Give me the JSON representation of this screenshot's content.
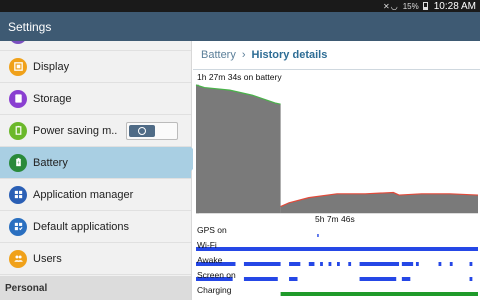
{
  "status_bar": {
    "battery_percent": "15%",
    "time": "10:28 AM"
  },
  "app_bar": {
    "title": "Settings"
  },
  "sidebar": {
    "items": [
      {
        "label": "Display",
        "icon": "display-icon",
        "color": "#f0a11a"
      },
      {
        "label": "Storage",
        "icon": "storage-icon",
        "color": "#8a3fd1"
      },
      {
        "label": "Power saving m..",
        "icon": "power-saving-icon",
        "color": "#6bb82a",
        "toggle": "on"
      },
      {
        "label": "Battery",
        "icon": "battery-icon",
        "color": "#2a8a3a",
        "active": true
      },
      {
        "label": "Application manager",
        "icon": "apps-grid-icon",
        "color": "#2a5fb5"
      },
      {
        "label": "Default applications",
        "icon": "default-apps-icon",
        "color": "#2a6fc0"
      },
      {
        "label": "Users",
        "icon": "users-icon",
        "color": "#f0a11a"
      }
    ],
    "section_header": "Personal"
  },
  "main": {
    "breadcrumb": {
      "parent": "Battery",
      "current": "History details"
    },
    "battery_duration": "1h 27m 34s on battery",
    "midpoint_label": "5h 7m 46s",
    "signals": [
      {
        "label": "GPS on"
      },
      {
        "label": "Wi-Fi"
      },
      {
        "label": "Awake"
      },
      {
        "label": "Screen on"
      },
      {
        "label": "Charging"
      }
    ]
  },
  "colors": {
    "app_bar": "#3e5a73",
    "active_item": "#a9cfe3",
    "graph_fill": "#7a7a7a",
    "signal_bar": "#2547e6",
    "charging_bar": "#1f9a2a",
    "discharge_line": "#4ab34a",
    "low_line": "#e24a3a"
  },
  "chart_data": {
    "type": "area",
    "title": "",
    "xlabel": "",
    "ylabel": "",
    "ylim": [
      0,
      100
    ],
    "segments": [
      {
        "name": "",
        "x": [
          0,
          0.03,
          0.12,
          0.2,
          0.28,
          0.3
        ],
        "y": [
          100,
          98,
          96,
          92,
          86,
          85
        ]
      },
      {
        "name": "",
        "x": [
          0.3,
          0.33,
          0.4,
          0.5,
          0.6,
          0.7,
          0.72,
          0.8,
          0.9,
          1.0
        ],
        "y": [
          5,
          8,
          12,
          15,
          15,
          16,
          14,
          15,
          15,
          14
        ]
      }
    ],
    "signals": {
      "gps": [
        [
          0.43,
          0.435
        ]
      ],
      "wifi": [
        [
          0.0,
          1.0
        ]
      ],
      "awake": [
        [
          0.0,
          0.14
        ],
        [
          0.17,
          0.3
        ],
        [
          0.33,
          0.37
        ],
        [
          0.4,
          0.42
        ],
        [
          0.44,
          0.45
        ],
        [
          0.47,
          0.48
        ],
        [
          0.5,
          0.51
        ],
        [
          0.54,
          0.55
        ],
        [
          0.58,
          0.72
        ],
        [
          0.73,
          0.77
        ],
        [
          0.78,
          0.79
        ],
        [
          0.86,
          0.87
        ],
        [
          0.9,
          0.91
        ],
        [
          0.97,
          0.98
        ]
      ],
      "screen_on": [
        [
          0.0,
          0.13
        ],
        [
          0.17,
          0.29
        ],
        [
          0.33,
          0.36
        ],
        [
          0.58,
          0.71
        ],
        [
          0.73,
          0.76
        ],
        [
          0.97,
          0.98
        ]
      ],
      "charging": [
        [
          0.3,
          1.0
        ]
      ]
    }
  }
}
